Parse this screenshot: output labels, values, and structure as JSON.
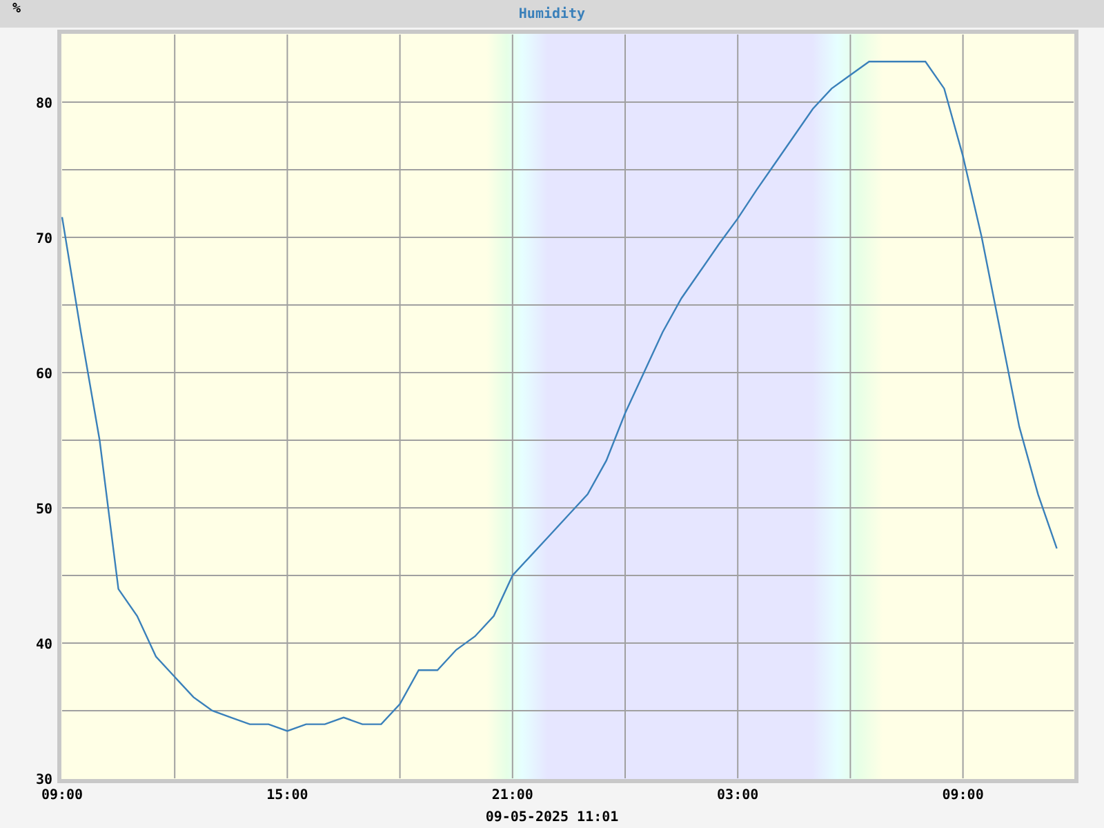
{
  "chart": {
    "chart_data": {
      "type": "line",
      "title": "Humidity",
      "ylabel": "%",
      "grid": true,
      "ylim": [
        30,
        85
      ],
      "yticks": [
        30,
        40,
        50,
        60,
        70,
        80
      ],
      "categories": [
        "09:00",
        null,
        null,
        null,
        null,
        null,
        null,
        null,
        null,
        null,
        null,
        null,
        "15:00",
        null,
        null,
        null,
        null,
        null,
        null,
        null,
        null,
        null,
        null,
        null,
        "21:00",
        null,
        null,
        null,
        null,
        null,
        null,
        null,
        null,
        null,
        null,
        null,
        "03:00",
        null,
        null,
        null,
        null,
        null,
        null,
        null,
        null,
        null,
        null,
        null,
        "09:00",
        null,
        null,
        null,
        null,
        null
      ],
      "series": [
        {
          "color": "#3a80ba",
          "values": [
            71.5,
            63,
            55,
            44,
            42,
            39,
            37.5,
            36,
            35,
            34.5,
            34,
            34,
            33.5,
            34,
            34,
            34.5,
            34,
            34,
            35.5,
            38,
            38,
            39.5,
            40.5,
            42,
            45,
            46.5,
            48,
            49.5,
            51,
            53.5,
            57,
            60,
            63,
            65.5,
            67.5,
            69.5,
            71.4,
            73.5,
            75.5,
            77.5,
            79.5,
            81,
            82,
            83,
            83,
            83,
            83,
            81,
            76,
            70,
            63,
            56,
            51,
            47
          ]
        }
      ]
    }
  },
  "timestamp": "09-05-2025 11:01"
}
